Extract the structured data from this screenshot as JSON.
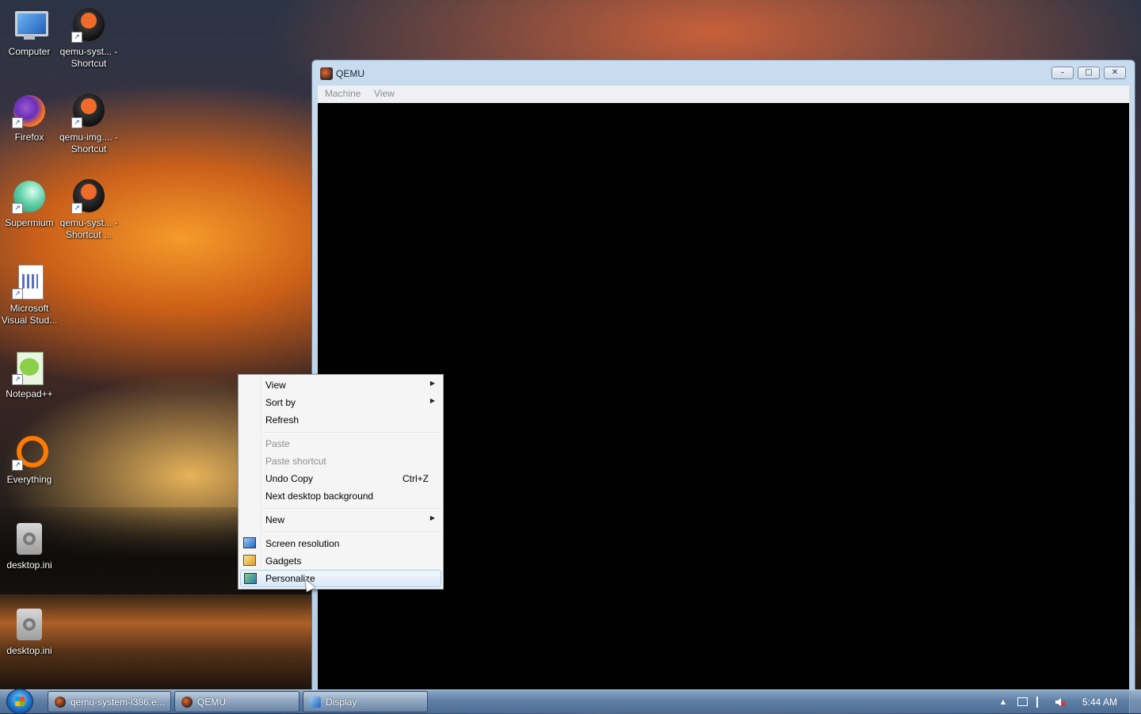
{
  "desktop": {
    "icons": [
      {
        "label": "Computer",
        "icon": "computer-icon"
      },
      {
        "label": "qemu-syst... - Shortcut",
        "icon": "qemu-icon"
      },
      {
        "label": "Firefox",
        "icon": "firefox-icon"
      },
      {
        "label": "qemu-img.... - Shortcut",
        "icon": "qemu-icon"
      },
      {
        "label": "Supermium",
        "icon": "supermium-icon"
      },
      {
        "label": "qemu-syst... - Shortcut ...",
        "icon": "qemu-icon"
      },
      {
        "label": "Microsoft Visual Stud...",
        "icon": "document-icon"
      },
      {
        "label": "Notepad++",
        "icon": "notepadpp-icon"
      },
      {
        "label": "Everything",
        "icon": "everything-icon"
      },
      {
        "label": "desktop.ini",
        "icon": "ini-file-icon"
      },
      {
        "label": "desktop.ini",
        "icon": "ini-file-icon"
      }
    ]
  },
  "qemu_window": {
    "title": "QEMU",
    "menu": [
      "Machine",
      "View"
    ],
    "buttons": {
      "minimize": "–",
      "maximize": "□",
      "close": "✕"
    }
  },
  "context_menu": {
    "items": [
      {
        "label": "View",
        "submenu": true
      },
      {
        "label": "Sort by",
        "submenu": true
      },
      {
        "label": "Refresh"
      },
      {
        "label": "Paste",
        "disabled": true
      },
      {
        "label": "Paste shortcut",
        "disabled": true
      },
      {
        "label": "Undo Copy",
        "shortcut": "Ctrl+Z"
      },
      {
        "label": "Next desktop background"
      },
      {
        "label": "New",
        "submenu": true
      },
      {
        "label": "Screen resolution",
        "icon": "screen-resolution-icon"
      },
      {
        "label": "Gadgets",
        "icon": "gadgets-icon"
      },
      {
        "label": "Personalize",
        "icon": "personalize-icon",
        "highlighted": true
      }
    ],
    "submenu_arrow": "▶"
  },
  "taskbar": {
    "buttons": [
      {
        "label": "qemu-system-i386.e...",
        "icon": "qemu-icon"
      },
      {
        "label": "QEMU",
        "icon": "qemu-icon"
      },
      {
        "label": "Display",
        "icon": "display-icon"
      }
    ],
    "tray": {
      "expand": "▲",
      "clock": "5:44 AM"
    }
  },
  "colors": {
    "accent": "#4c6c94",
    "highlight": "#dce9f8"
  }
}
